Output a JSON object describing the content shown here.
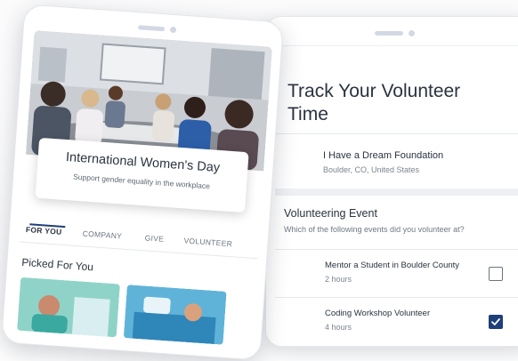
{
  "right_screen": {
    "title": "Track Your Volunteer Time",
    "organization": {
      "name": "I Have a Dream Foundation",
      "location": "Boulder, CO, United States"
    },
    "section": {
      "title": "Volunteering Event",
      "subtitle": "Which of the following events did you volunteer at?"
    },
    "events": [
      {
        "name": "Mentor a Student in Boulder County",
        "hours": "2 hours",
        "checked": false
      },
      {
        "name": "Coding Workshop Volunteer",
        "hours": "4 hours",
        "checked": true
      }
    ]
  },
  "left_screen": {
    "event_card": {
      "title": "International Women's Day",
      "subtitle": "Support gender equality in the workplace"
    },
    "tabs": [
      "FOR YOU",
      "COMPANY",
      "GIVE",
      "VOLUNTEER"
    ],
    "active_tab": "FOR YOU",
    "section_title": "Picked For You"
  },
  "colors": {
    "accent": "#1f3f7a",
    "text": "#2a3340",
    "muted": "#7b8591"
  }
}
